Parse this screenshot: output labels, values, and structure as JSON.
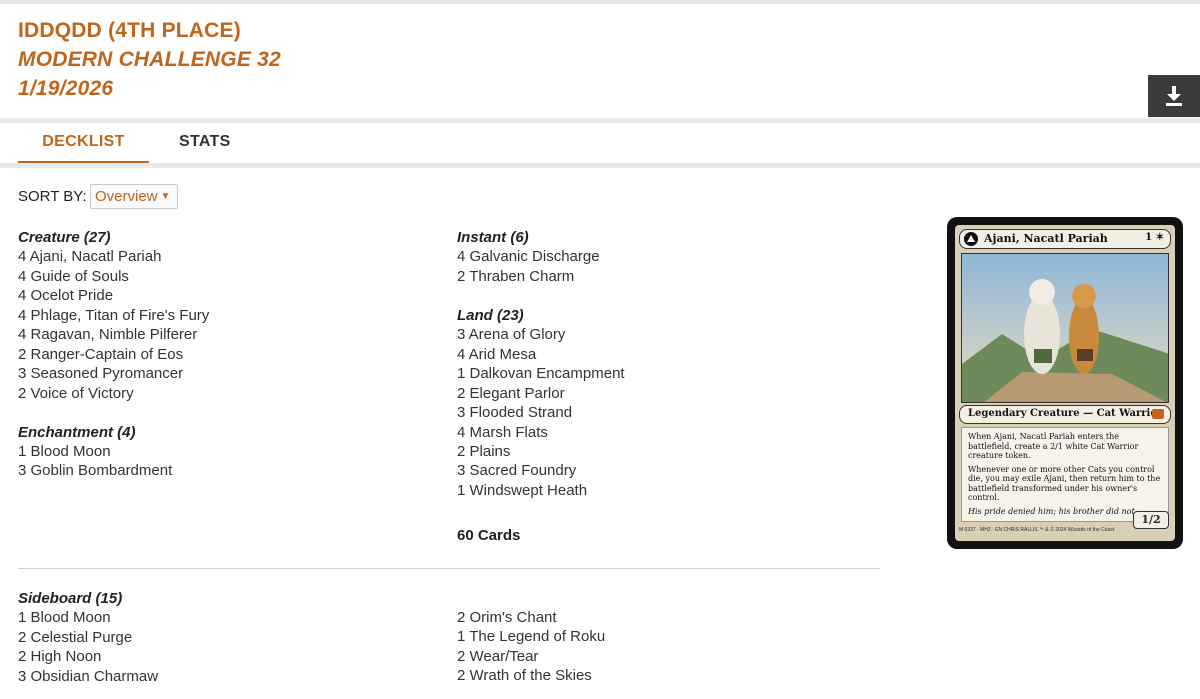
{
  "header": {
    "player": "IDDQDD (4TH PLACE)",
    "event": "MODERN CHALLENGE 32",
    "date": "1/19/2026",
    "download_icon": "download-icon"
  },
  "tabs": [
    {
      "label": "DECKLIST",
      "active": true
    },
    {
      "label": "STATS",
      "active": false
    }
  ],
  "sort": {
    "label": "SORT BY:",
    "selected": "Overview"
  },
  "decklist": {
    "left": [
      {
        "title": "Creature (27)",
        "cards": [
          "4 Ajani, Nacatl Pariah",
          "4 Guide of Souls",
          "4 Ocelot Pride",
          "4 Phlage, Titan of Fire's Fury",
          "4 Ragavan, Nimble Pilferer",
          "2 Ranger-Captain of Eos",
          "3 Seasoned Pyromancer",
          "2 Voice of Victory"
        ]
      },
      {
        "title": "Enchantment (4)",
        "cards": [
          "1 Blood Moon",
          "3 Goblin Bombardment"
        ]
      }
    ],
    "right": [
      {
        "title": "Instant (6)",
        "cards": [
          "4 Galvanic Discharge",
          "2 Thraben Charm"
        ]
      },
      {
        "title": "Land (23)",
        "cards": [
          "3 Arena of Glory",
          "4 Arid Mesa",
          "1 Dalkovan Encampment",
          "2 Elegant Parlor",
          "3 Flooded Strand",
          "4 Marsh Flats",
          "2 Plains",
          "3 Sacred Foundry",
          "1 Windswept Heath"
        ]
      }
    ],
    "total": "60 Cards"
  },
  "sideboard": {
    "title": "Sideboard (15)",
    "left": [
      "1 Blood Moon",
      "2 Celestial Purge",
      "2 High Noon",
      "3 Obsidian Charmaw"
    ],
    "right": [
      "2 Orim's Chant",
      "1 The Legend of Roku",
      "2 Wear/Tear",
      "2 Wrath of the Skies"
    ]
  },
  "card_preview": {
    "name": "Ajani, Nacatl Pariah",
    "mana": "1 ✶",
    "type_line": "Legendary Creature — Cat Warrior",
    "rules_1": "When Ajani, Nacatl Pariah enters the battlefield, create a 2/1 white Cat Warrior creature token.",
    "rules_2": "Whenever one or more other Cats you control die, you may exile Ajani, then return him to the battlefield transformed under his owner's control.",
    "flavor": "His pride denied him; his brother did not.",
    "pt": "1/2",
    "footer": "M 0237 · MH3 · EN   CHRIS RALLIS   ™ & © 2024 Wizards of the Coast"
  },
  "colors": {
    "accent": "#c0651b",
    "download_bg": "#3b3b3b"
  }
}
